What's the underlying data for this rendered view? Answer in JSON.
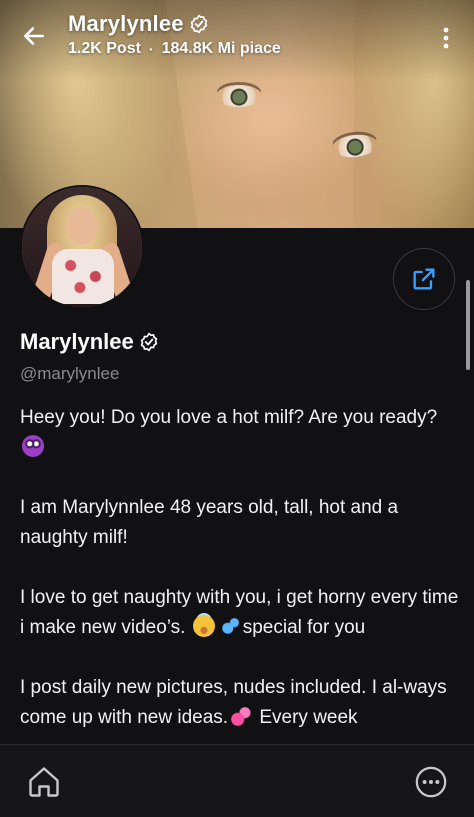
{
  "header": {
    "title": "Marylynlee",
    "posts": "1.2K Post",
    "likes": "184.8K Mi piace",
    "separator": "·"
  },
  "profile": {
    "name": "Marylynlee",
    "handle": "@marylynlee",
    "verified": true
  },
  "bio": {
    "p1": "Heey you! Do you love a hot milf? Are you ready?",
    "p2": "I am Marylynnlee 48 years old, tall, hot and a naughty milf!",
    "p3_a": "I love to get naughty with you, i get horny every time i make new video’s.",
    "p3_b": "special for you",
    "p4_a": "I post daily new pictures, nudes included. I al-ways come up with new ideas.",
    "p4_b": "Every week"
  },
  "icons": {
    "back": "arrow-left-icon",
    "menu": "vertical-dots-icon",
    "verified": "verified-badge-icon",
    "share": "share-icon",
    "home": "home-icon",
    "more": "more-horizontal-icon"
  },
  "colors": {
    "background": "#111113",
    "accent": "#3aa0ff",
    "muted_text": "#8a8a91"
  }
}
